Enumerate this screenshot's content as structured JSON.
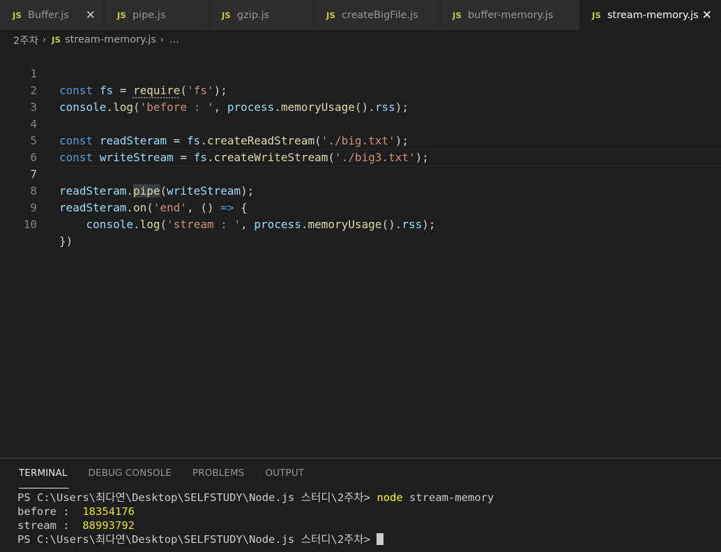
{
  "tabs": [
    {
      "name": "Buffer.js",
      "active": false,
      "closable": true
    },
    {
      "name": "pipe.js",
      "active": false
    },
    {
      "name": "gzip.js",
      "active": false
    },
    {
      "name": "createBigFile.js",
      "active": false
    },
    {
      "name": "buffer-memory.js",
      "active": false
    },
    {
      "name": "stream-memory.js",
      "active": true,
      "closable": true
    }
  ],
  "js_badge": "JS",
  "close_glyph": "✕",
  "breadcrumb": {
    "folder": "2주차",
    "sep": "›",
    "file": "stream-memory.js",
    "tail": "..."
  },
  "editor": {
    "line_numbers": [
      "1",
      "2",
      "3",
      "4",
      "5",
      "6",
      "7",
      "8",
      "9",
      "10"
    ],
    "l1": {
      "kw": "const",
      "var": "fs",
      "eq": " = ",
      "fn": "require",
      "p1": "(",
      "str": "'fs'",
      "p2": ");"
    },
    "l2": {
      "var1": "console",
      "dot1": ".",
      "fn1": "log",
      "p1": "(",
      "str": "'before : '",
      "comma": ", ",
      "var2": "process",
      "dot2": ".",
      "fn2": "memoryUsage",
      "p2": "().",
      "var3": "rss",
      "p3": ");"
    },
    "l4": {
      "kw": "const",
      "var1": "readSteram",
      "eq": " = ",
      "var2": "fs",
      "dot": ".",
      "fn": "createReadStream",
      "p1": "(",
      "str": "'./big.txt'",
      "p2": ");"
    },
    "l5": {
      "kw": "const",
      "var1": "writeStream",
      "eq": " = ",
      "var2": "fs",
      "dot": ".",
      "fn": "createWriteStream",
      "p1": "(",
      "str": "'./big3.txt'",
      "p2": ");"
    },
    "l7": {
      "var1": "readSteram",
      "dot": ".",
      "fn": "pipe",
      "p1": "(",
      "var2": "writeStream",
      "p2": ");"
    },
    "l8": {
      "var1": "readSteram",
      "dot": ".",
      "fn": "on",
      "p1": "(",
      "str": "'end'",
      "comma": ", () ",
      "arrow": "=>",
      "p2": " {"
    },
    "l9": {
      "indent": "    ",
      "var1": "console",
      "dot1": ".",
      "fn1": "log",
      "p1": "(",
      "str": "'stream : '",
      "comma": ", ",
      "var2": "process",
      "dot2": ".",
      "fn2": "memoryUsage",
      "p2": "().",
      "var3": "rss",
      "p3": ");"
    },
    "l10": {
      "text": "})"
    }
  },
  "panel": {
    "tabs": [
      "TERMINAL",
      "DEBUG CONSOLE",
      "PROBLEMS",
      "OUTPUT"
    ],
    "active": "TERMINAL"
  },
  "terminal": {
    "prompt": "PS C:\\Users\\최다연\\Desktop\\SELFSTUDY\\Node.js 스터디\\2주차> ",
    "command_keyword": "node",
    "command_args": " stream-memory",
    "before_label": "before :  ",
    "before_value": "18354176",
    "stream_label": "stream :  ",
    "stream_value": "88993792"
  },
  "colors": {
    "keyword": "#569cd6",
    "variable": "#9cdcfe",
    "function": "#dcdcaa",
    "string": "#ce9178",
    "js_icon": "#cbcb41",
    "terminal_command": "#ffff00",
    "terminal_number": "#e5e510"
  }
}
